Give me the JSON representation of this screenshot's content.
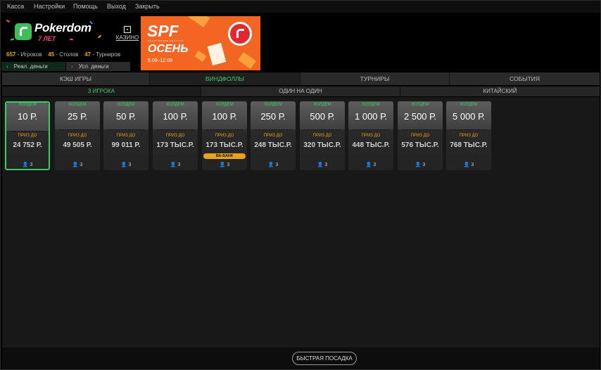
{
  "menu": [
    "Касса",
    "Настройки",
    "Помощь",
    "Выход",
    "Закрыть"
  ],
  "logo": {
    "name": "Pokerdom",
    "years": "7 ЛЕТ"
  },
  "casino": {
    "icon": "dice-icon",
    "label": "КАЗИНО"
  },
  "stats": {
    "players_count": "657",
    "players_label": " - Игроков",
    "tables_count": "45",
    "tables_label": " - Столов",
    "tournaments_count": "47",
    "tournaments_label": " - Турниров"
  },
  "money_tabs": [
    {
      "label": "Реал. деньги",
      "active": true
    },
    {
      "label": "Усл. деньги",
      "active": false
    }
  ],
  "banner": {
    "title": "SPF",
    "subtitle": "SOCHI POKER FESTIVAL",
    "season": "ОСЕНЬ",
    "dates": "5.09–12.09"
  },
  "main_tabs": [
    "КЭШ ИГРЫ",
    "ВИНДФОЛЛЫ",
    "ТУРНИРЫ",
    "СОБЫТИЯ"
  ],
  "sub_tabs": [
    "3 ИГРОКА",
    "ОДИН НА ОДИН",
    "КИТАЙСКИЙ"
  ],
  "cards": [
    {
      "label": "ХОЛДЕМ",
      "buyin": "10 Р.",
      "prize_label": "ПРИЗ ДО",
      "prize": "24 752 Р.",
      "players": "3",
      "badge": ""
    },
    {
      "label": "ХОЛДЕМ",
      "buyin": "25 Р.",
      "prize_label": "ПРИЗ ДО",
      "prize": "49 505 Р.",
      "players": "3",
      "badge": ""
    },
    {
      "label": "ХОЛДЕМ",
      "buyin": "50 Р.",
      "prize_label": "ПРИЗ ДО",
      "prize": "99 011 Р.",
      "players": "3",
      "badge": ""
    },
    {
      "label": "ХОЛДЕМ",
      "buyin": "100 Р.",
      "prize_label": "ПРИЗ ДО",
      "prize": "173 ТЫС.Р.",
      "players": "3",
      "badge": ""
    },
    {
      "label": "ХОЛДЕМ",
      "buyin": "100 Р.",
      "prize_label": "ПРИЗ ДО",
      "prize": "173 ТЫС.Р.",
      "players": "3",
      "badge": "ВА-БАНК"
    },
    {
      "label": "ХОЛДЕМ",
      "buyin": "250 Р.",
      "prize_label": "ПРИЗ ДО",
      "prize": "248 ТЫС.Р.",
      "players": "3",
      "badge": ""
    },
    {
      "label": "ХОЛДЕМ",
      "buyin": "500 Р.",
      "prize_label": "ПРИЗ ДО",
      "prize": "320 ТЫС.Р.",
      "players": "3",
      "badge": ""
    },
    {
      "label": "ХОЛДЕМ",
      "buyin": "1 000 Р.",
      "prize_label": "ПРИЗ ДО",
      "prize": "448 ТЫС.Р.",
      "players": "3",
      "badge": ""
    },
    {
      "label": "ХОЛДЕМ",
      "buyin": "2 500 Р.",
      "prize_label": "ПРИЗ ДО",
      "prize": "576 ТЫС.Р.",
      "players": "3",
      "badge": ""
    },
    {
      "label": "ХОЛДЕМ",
      "buyin": "5 000 Р.",
      "prize_label": "ПРИЗ ДО",
      "prize": "768 ТЫС.Р.",
      "players": "3",
      "badge": ""
    }
  ],
  "quick_seat": "БЫСТРАЯ ПОСАДКА",
  "colors": {
    "accent": "#3dcb68",
    "prize": "#e8a21b",
    "banner": "#f26522"
  }
}
